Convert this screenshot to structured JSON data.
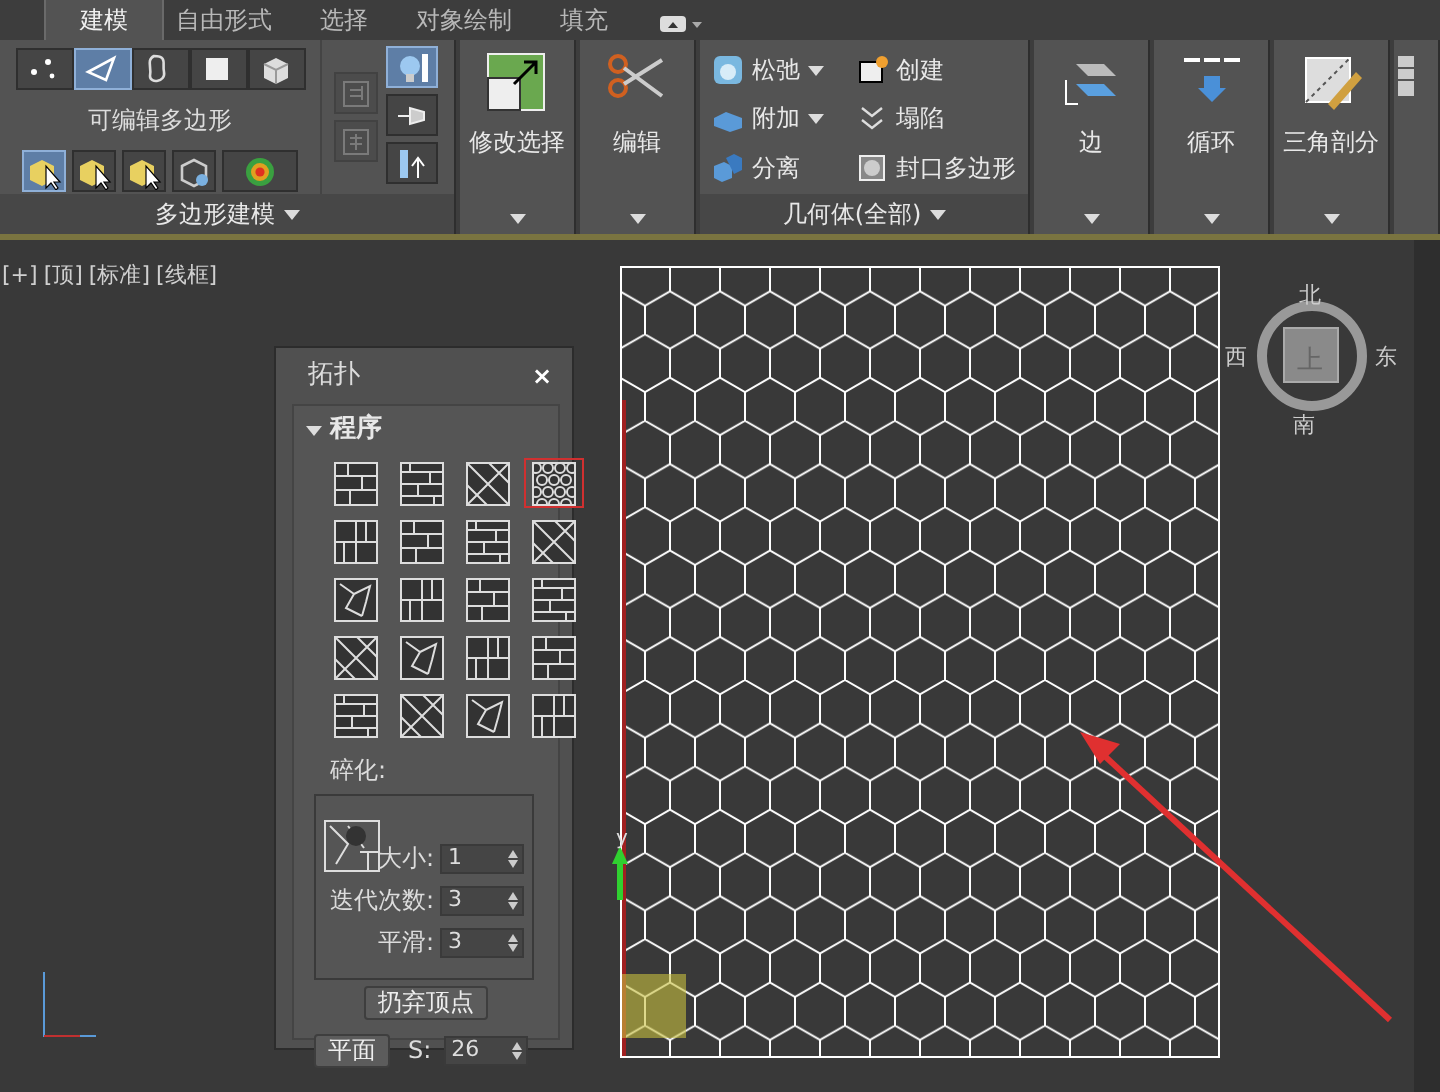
{
  "ribbon": {
    "tabs": [
      {
        "label": "建模",
        "selected": true
      },
      {
        "label": "自由形式",
        "selected": false
      },
      {
        "label": "选择",
        "selected": false
      },
      {
        "label": "对象绘制",
        "selected": false
      },
      {
        "label": "填充",
        "selected": false
      }
    ],
    "polygon_modeling": {
      "title": "多边形建模",
      "caption": "可编辑多边形",
      "subobjects": [
        {
          "kind": "vertex",
          "selected": false
        },
        {
          "kind": "edge",
          "selected": true
        },
        {
          "kind": "border",
          "selected": false
        },
        {
          "kind": "polygon",
          "selected": false
        },
        {
          "kind": "element",
          "selected": false
        }
      ],
      "tools": [
        {
          "kind": "cube",
          "selected": true
        },
        {
          "kind": "cube",
          "selected": false
        },
        {
          "kind": "cube",
          "selected": false
        },
        {
          "kind": "cage",
          "selected": false
        },
        {
          "kind": "soft",
          "selected": false
        }
      ],
      "side_tools": [
        {
          "kind": "stack-up",
          "disabled": true
        },
        {
          "kind": "stack-down",
          "disabled": true
        }
      ],
      "side_tools_2": [
        {
          "kind": "bulb",
          "selected": true
        },
        {
          "kind": "pin",
          "selected": false
        },
        {
          "kind": "pivot",
          "selected": false
        }
      ]
    },
    "modify_selection": {
      "label": "修改选择"
    },
    "edit": {
      "label": "编辑"
    },
    "geometry": {
      "title": "几何体(全部)",
      "items": [
        {
          "kind": "relax",
          "label": "松弛",
          "dropdown": true
        },
        {
          "kind": "create",
          "label": "创建",
          "dropdown": false
        },
        {
          "kind": "attach",
          "label": "附加",
          "dropdown": true
        },
        {
          "kind": "collapse",
          "label": "塌陷",
          "dropdown": false
        },
        {
          "kind": "detach",
          "label": "分离",
          "dropdown": false
        },
        {
          "kind": "cap",
          "label": "封口多边形",
          "dropdown": false
        }
      ]
    },
    "big_buttons": [
      {
        "kind": "edge",
        "label": "边"
      },
      {
        "kind": "loop",
        "label": "循环"
      },
      {
        "kind": "triangulate",
        "label": "三角剖分"
      }
    ]
  },
  "viewport": {
    "labels": [
      "[+]",
      "[顶]",
      "[标准]",
      "[线框]"
    ],
    "viewcube": {
      "north": "北",
      "west": "西",
      "east": "东",
      "south": "南",
      "face": "上"
    },
    "gizmo_label": "y"
  },
  "topology_panel": {
    "title": "拓扑",
    "close": "×",
    "rollout": "程序",
    "patterns": [
      {
        "selected": false
      },
      {
        "selected": false
      },
      {
        "selected": false
      },
      {
        "selected": true
      },
      {
        "selected": false
      },
      {
        "selected": false
      },
      {
        "selected": false
      },
      {
        "selected": false
      },
      {
        "selected": false
      },
      {
        "selected": false
      },
      {
        "selected": false
      },
      {
        "selected": false
      },
      {
        "selected": false
      },
      {
        "selected": false
      },
      {
        "selected": false
      },
      {
        "selected": false
      },
      {
        "selected": false
      },
      {
        "selected": false
      },
      {
        "selected": false
      },
      {
        "selected": false
      }
    ],
    "subdivide": {
      "title": "碎化:",
      "fields": [
        {
          "label": "大小:",
          "value": "1"
        },
        {
          "label": "迭代次数:",
          "value": "3"
        },
        {
          "label": "平滑:",
          "value": "3"
        }
      ]
    },
    "discard_button": "扔弃顶点",
    "plane_button": "平面",
    "s_label": "S:",
    "s_value": "26"
  }
}
